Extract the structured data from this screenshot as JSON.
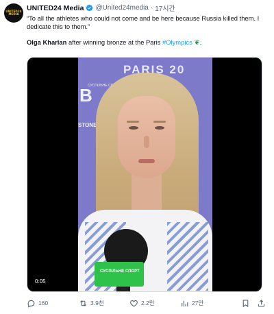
{
  "account": {
    "avatar_text": "UNITED24 MEDIA",
    "name": "UNITED24 Media",
    "handle": "@United24media",
    "separator": "·",
    "time": "17시간"
  },
  "tweet": {
    "quote": "“To all the athletes who could not come and be here because Russia killed them. I dedicate this to them.”",
    "author_bold": "Olga Kharlan",
    "caption_mid": " after winning bronze at the Paris ",
    "hashtag": "#Olympics",
    "caption_end": "."
  },
  "video": {
    "backdrop_text": "PARIS 20",
    "side_logo": "B",
    "side_text": "STONE",
    "small_brand": "СУСПІЛЬНЕ СПОРТ",
    "mic_brand": "СУСПІЛЬНЕ СПОРТ",
    "timestamp": "0:05"
  },
  "actions": {
    "replies": "160",
    "reposts": "3.9천",
    "likes": "2.2만",
    "views": "27만"
  },
  "colors": {
    "accent": "#1d9bf0",
    "text": "#0f1419",
    "secondary": "#536471",
    "broadcaster_green": "#2ec24a"
  }
}
